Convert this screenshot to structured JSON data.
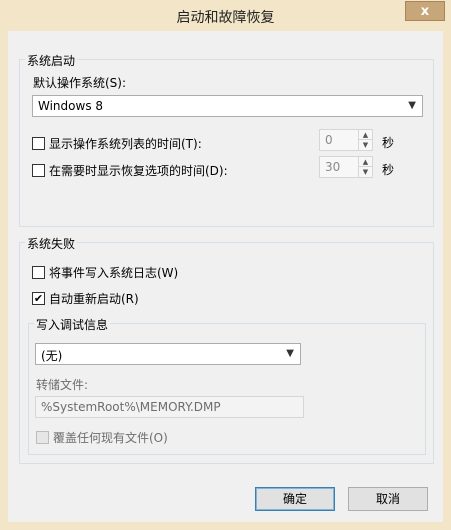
{
  "window": {
    "title": "启动和故障恢复",
    "close_label": "x"
  },
  "system_startup": {
    "group_label": "系统启动",
    "default_os_label": "默认操作系统(S):",
    "default_os_value": "Windows 8",
    "show_list_label": "显示操作系统列表的时间(T):",
    "show_list_checked": false,
    "show_list_value": "0",
    "show_recovery_label": "在需要时显示恢复选项的时间(D):",
    "show_recovery_checked": false,
    "show_recovery_value": "30",
    "unit_label": "秒"
  },
  "system_failure": {
    "group_label": "系统失败",
    "write_event_label": "将事件写入系统日志(W)",
    "write_event_checked": false,
    "auto_restart_label": "自动重新启动(R)",
    "auto_restart_checked": true,
    "debug_info": {
      "group_label": "写入调试信息",
      "selected_value": "(无)",
      "dump_file_label": "转储文件:",
      "dump_file_value": "%SystemRoot%\\MEMORY.DMP",
      "overwrite_label": "覆盖任何现有文件(O)",
      "overwrite_checked": false
    }
  },
  "buttons": {
    "ok_label": "确定",
    "cancel_label": "取消"
  },
  "icons": {
    "checkmark": "✔",
    "dropdown": "▼",
    "spin_up": "▲",
    "spin_down": "▼"
  }
}
